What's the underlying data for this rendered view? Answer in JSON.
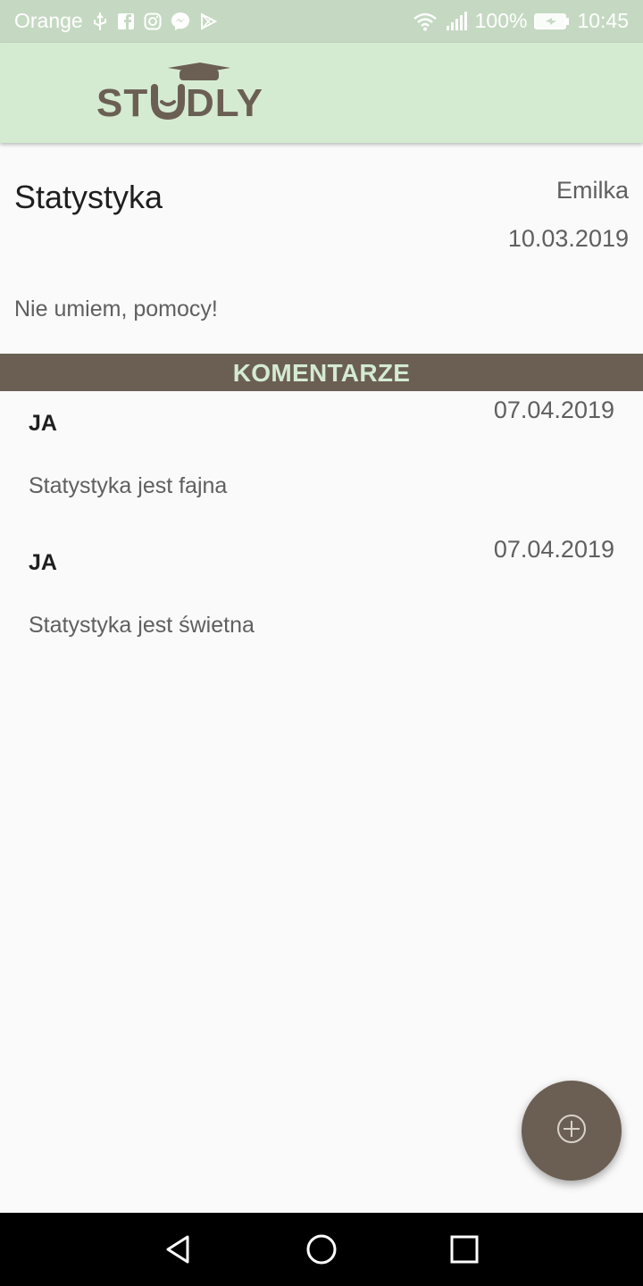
{
  "status_bar": {
    "carrier": "Orange",
    "battery": "100%",
    "time": "10:45",
    "icons": [
      "usb-icon",
      "facebook-icon",
      "instagram-icon",
      "messenger-icon",
      "play-store-icon",
      "wifi-icon",
      "signal-icon",
      "battery-icon"
    ]
  },
  "app_bar": {
    "logo_text": "STUDLY",
    "logo_color": "#6b5f54",
    "background": "#d4ebd2"
  },
  "post": {
    "title": "Statystyka",
    "author": "Emilka",
    "date": "10.03.2019",
    "body": "Nie umiem, pomocy!"
  },
  "comments_section": {
    "header": "KOMENTARZE",
    "header_background": "#6b5f54",
    "header_color": "#d4ebd2"
  },
  "comments": [
    {
      "author": "JA",
      "date": "07.04.2019",
      "text": "Statystyka jest fajna"
    },
    {
      "author": "JA",
      "date": "07.04.2019",
      "text": "Statystyka jest świetna"
    }
  ],
  "fab": {
    "icon": "add-circle-icon",
    "color": "#6b5f54"
  },
  "nav_bar": {
    "icons": [
      "back-icon",
      "home-icon",
      "recents-icon"
    ]
  }
}
